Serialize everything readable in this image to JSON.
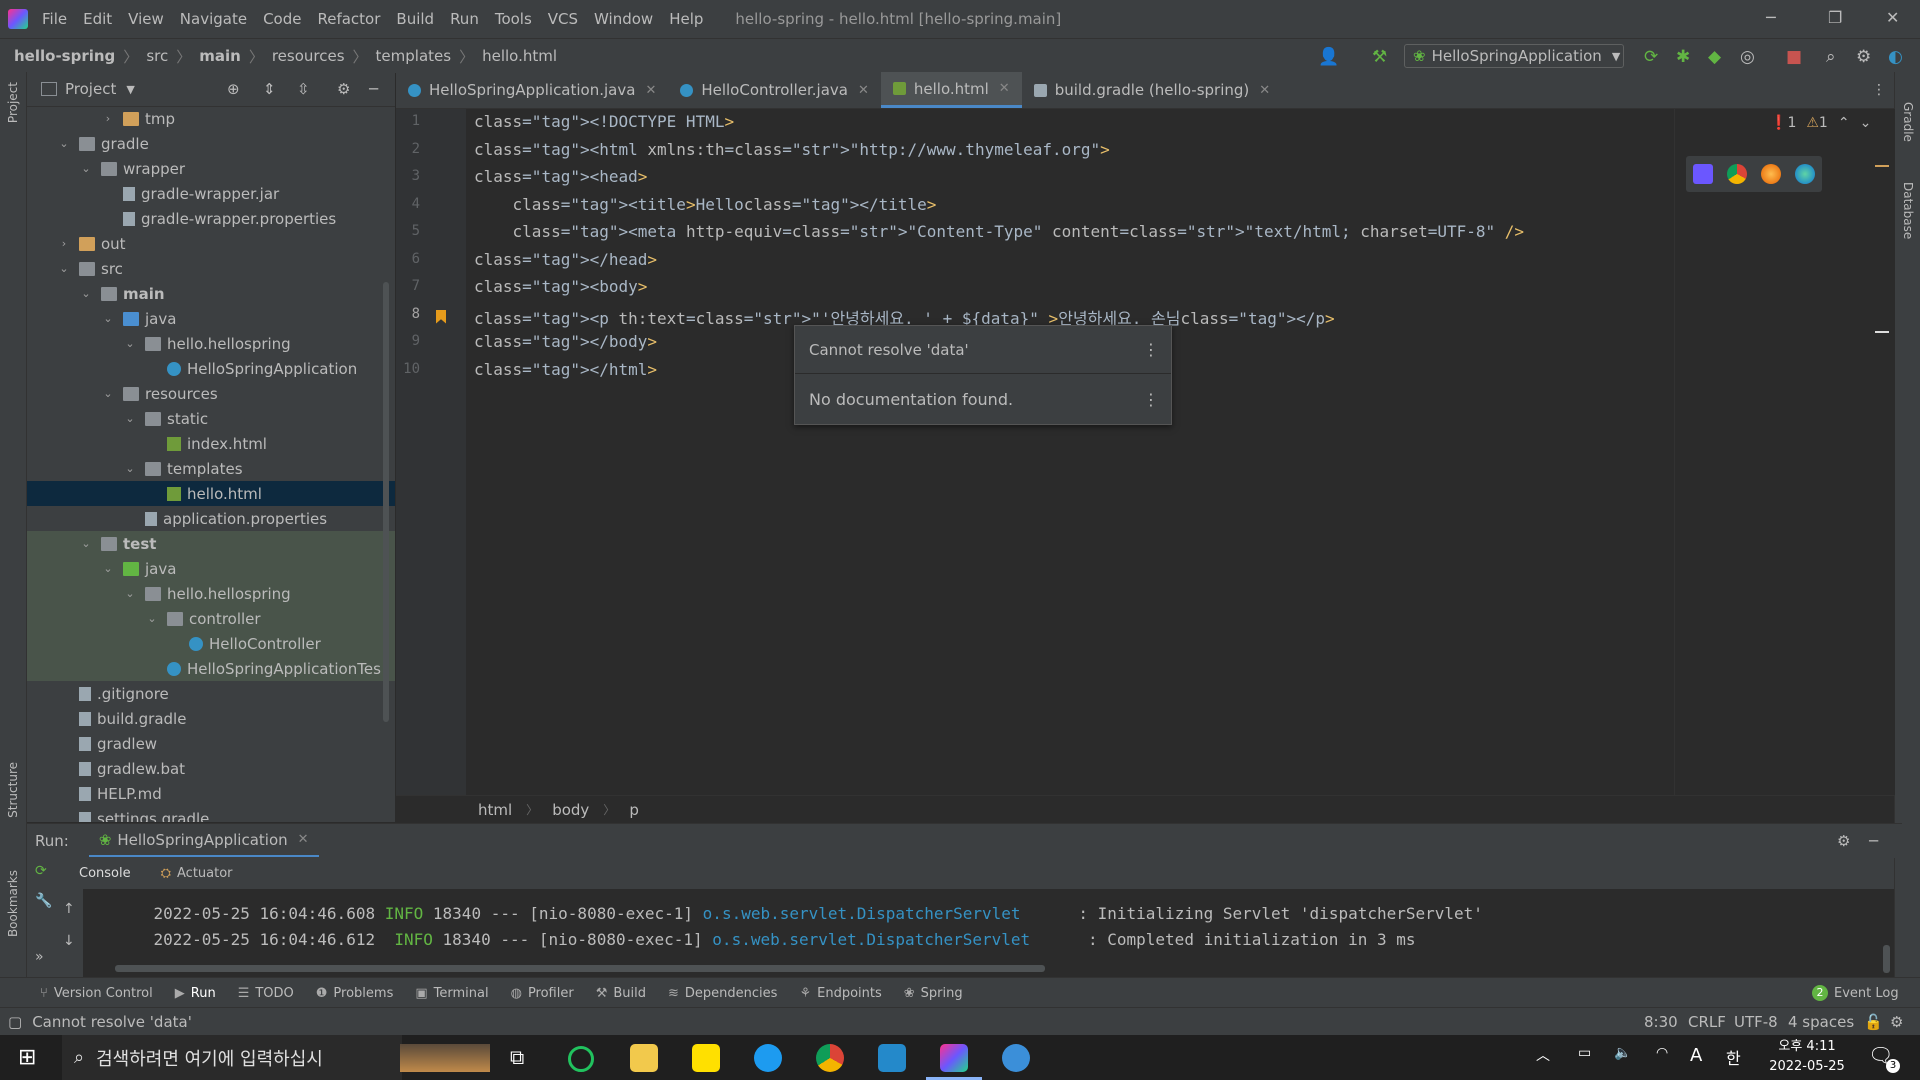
{
  "window": {
    "menu": [
      "File",
      "Edit",
      "View",
      "Navigate",
      "Code",
      "Refactor",
      "Build",
      "Run",
      "Tools",
      "VCS",
      "Window",
      "Help"
    ],
    "title": "hello-spring - hello.html [hello-spring.main]"
  },
  "breadcrumb": [
    "hello-spring",
    "src",
    "main",
    "resources",
    "templates",
    "hello.html"
  ],
  "run_config": "HelloSpringApplication",
  "project_panel": {
    "title": "Project",
    "tree": [
      {
        "label": "tmp",
        "depth": 3,
        "expand": "closed",
        "icon": "folder-orange"
      },
      {
        "label": "gradle",
        "depth": 1,
        "expand": "open",
        "icon": "folder"
      },
      {
        "label": "wrapper",
        "depth": 2,
        "expand": "open",
        "icon": "folder"
      },
      {
        "label": "gradle-wrapper.jar",
        "depth": 3,
        "expand": "",
        "icon": "file"
      },
      {
        "label": "gradle-wrapper.properties",
        "depth": 3,
        "expand": "",
        "icon": "file"
      },
      {
        "label": "out",
        "depth": 1,
        "expand": "closed",
        "icon": "folder-orange"
      },
      {
        "label": "src",
        "depth": 1,
        "expand": "open",
        "icon": "folder"
      },
      {
        "label": "main",
        "depth": 2,
        "expand": "open",
        "icon": "folder"
      },
      {
        "label": "java",
        "depth": 3,
        "expand": "open",
        "icon": "folder-blue"
      },
      {
        "label": "hello.hellospring",
        "depth": 4,
        "expand": "open",
        "icon": "folder"
      },
      {
        "label": "HelloSpringApplication",
        "depth": 5,
        "expand": "",
        "icon": "class"
      },
      {
        "label": "resources",
        "depth": 3,
        "expand": "open",
        "icon": "folder"
      },
      {
        "label": "static",
        "depth": 4,
        "expand": "open",
        "icon": "folder"
      },
      {
        "label": "index.html",
        "depth": 5,
        "expand": "",
        "icon": "html"
      },
      {
        "label": "templates",
        "depth": 4,
        "expand": "open",
        "icon": "folder"
      },
      {
        "label": "hello.html",
        "depth": 5,
        "expand": "",
        "icon": "html",
        "selected": true
      },
      {
        "label": "application.properties",
        "depth": 4,
        "expand": "",
        "icon": "file"
      },
      {
        "label": "test",
        "depth": 2,
        "expand": "open",
        "icon": "folder",
        "test": true
      },
      {
        "label": "java",
        "depth": 3,
        "expand": "open",
        "icon": "folder-green",
        "test": true
      },
      {
        "label": "hello.hellospring",
        "depth": 4,
        "expand": "open",
        "icon": "folder",
        "test": true
      },
      {
        "label": "controller",
        "depth": 5,
        "expand": "open",
        "icon": "folder",
        "test": true
      },
      {
        "label": "HelloController",
        "depth": 6,
        "expand": "",
        "icon": "class",
        "test": true
      },
      {
        "label": "HelloSpringApplicationTes",
        "depth": 5,
        "expand": "",
        "icon": "class",
        "test": true
      },
      {
        "label": ".gitignore",
        "depth": 1,
        "expand": "",
        "icon": "file"
      },
      {
        "label": "build.gradle",
        "depth": 1,
        "expand": "",
        "icon": "file"
      },
      {
        "label": "gradlew",
        "depth": 1,
        "expand": "",
        "icon": "file"
      },
      {
        "label": "gradlew.bat",
        "depth": 1,
        "expand": "",
        "icon": "file"
      },
      {
        "label": "HELP.md",
        "depth": 1,
        "expand": "",
        "icon": "file"
      },
      {
        "label": "settings.gradle",
        "depth": 1,
        "expand": "",
        "icon": "file"
      }
    ]
  },
  "tabs": [
    {
      "label": "HelloSpringApplication.java",
      "active": false
    },
    {
      "label": "HelloController.java",
      "active": false
    },
    {
      "label": "hello.html",
      "active": true
    },
    {
      "label": "build.gradle (hello-spring)",
      "active": false
    }
  ],
  "editor": {
    "lines": [
      {
        "n": "1",
        "t": "<!DOCTYPE HTML>"
      },
      {
        "n": "2",
        "t": "<html xmlns:th=\"http://www.thymeleaf.org\">"
      },
      {
        "n": "3",
        "t": "<head>"
      },
      {
        "n": "4",
        "t": "    <title>Hello</title>"
      },
      {
        "n": "5",
        "t": "    <meta http-equiv=\"Content-Type\" content=\"text/html; charset=UTF-8\" />"
      },
      {
        "n": "6",
        "t": "</head>"
      },
      {
        "n": "7",
        "t": "<body>"
      },
      {
        "n": "8",
        "t": "<p th:text=\"'안녕하세요. ' + ${data}\" >안녕하세요. 손님</p>"
      },
      {
        "n": "9",
        "t": "</body>"
      },
      {
        "n": "10",
        "t": "</html>"
      }
    ],
    "errors": "1",
    "warnings": "1"
  },
  "popup": {
    "title": "Cannot resolve 'data'",
    "body": "No documentation found."
  },
  "editor_breadcrumb": [
    "html",
    "body",
    "p"
  ],
  "run_panel": {
    "label": "Run:",
    "tab": "HelloSpringApplication",
    "subtabs": [
      "Console",
      "Actuator"
    ],
    "log": [
      {
        "ts": "2022-05-25 16:04:46.608",
        "level": "INFO",
        "pid": "18340",
        "sep": "---",
        "thread": "[nio-8080-exec-1]",
        "logger": "o.s.web.servlet.DispatcherServlet",
        "msg": ": Initializing Servlet 'dispatcherServlet'"
      },
      {
        "ts": "2022-05-25 16:04:46.612",
        "level": "INFO",
        "pid": "18340",
        "sep": "---",
        "thread": "[nio-8080-exec-1]",
        "logger": "o.s.web.servlet.DispatcherServlet",
        "msg": ": Completed initialization in 3 ms"
      }
    ]
  },
  "bottom_tabs": [
    "Version Control",
    "Run",
    "TODO",
    "Problems",
    "Terminal",
    "Profiler",
    "Build",
    "Dependencies",
    "Endpoints",
    "Spring"
  ],
  "event_log": {
    "count": "2",
    "label": "Event Log"
  },
  "status": {
    "message": "Cannot resolve 'data'",
    "position": "8:30",
    "line_sep": "CRLF",
    "encoding": "UTF-8",
    "indent": "4 spaces"
  },
  "left_strip": [
    "Project",
    "Structure",
    "Bookmarks"
  ],
  "right_strip": [
    "Gradle",
    "Database"
  ],
  "taskbar": {
    "search_placeholder": "검색하려면 여기에 입력하십시",
    "time": "오후 4:11",
    "date": "2022-05-25",
    "ime1": "A",
    "ime2": "한",
    "notif": "3"
  }
}
